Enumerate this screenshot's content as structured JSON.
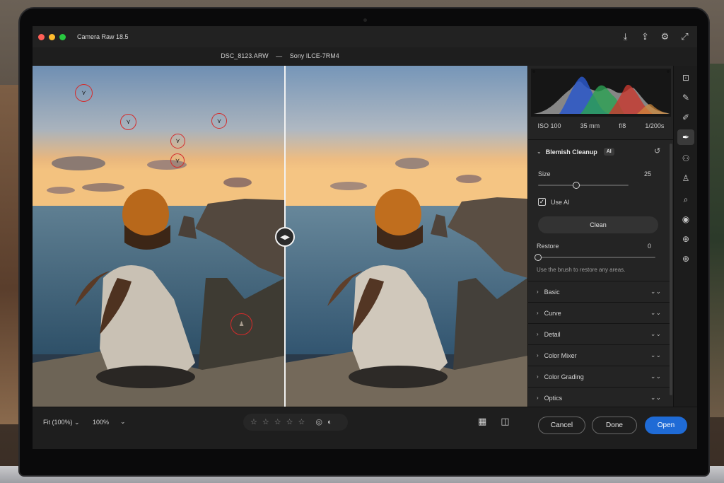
{
  "window": {
    "app_title": "Camera Raw 18.5",
    "file_name": "DSC_8123.ARW",
    "separator": "—",
    "camera_model": "Sony ILCE-7RM4"
  },
  "title_icons": [
    "download-icon",
    "share-icon",
    "gear-icon",
    "expand-icon"
  ],
  "camera_info": {
    "iso": "ISO 100",
    "focal_length": "35 mm",
    "aperture": "f/8",
    "shutter": "1/200s"
  },
  "blemish": {
    "title": "Blemish Cleanup",
    "ai_badge": "AI",
    "size_label": "Size",
    "size_value": "25",
    "size_fraction": 0.42,
    "use_ai_label": "Use AI",
    "use_ai_checked": true,
    "clean_label": "Clean",
    "restore_label": "Restore",
    "restore_value": "0",
    "restore_fraction": 0,
    "hint": "Use the brush to restore any areas."
  },
  "panels": [
    "Basic",
    "Curve",
    "Detail",
    "Color Mixer",
    "Color Grading",
    "Optics"
  ],
  "tools": [
    "crop-icon",
    "heal-icon",
    "brush-icon",
    "eyedropper-icon",
    "mask-icon",
    "people-icon",
    "zoom-icon",
    "redeye-icon",
    "snapshot-icon",
    "presets-icon"
  ],
  "bottom": {
    "fit_label": "Fit (100%)",
    "zoom_label": "100%",
    "star_count": 5,
    "cancel_label": "Cancel",
    "done_label": "Done",
    "open_label": "Open"
  },
  "colors": {
    "accent": "#1f6bd6",
    "mark": "#d52b2b"
  }
}
